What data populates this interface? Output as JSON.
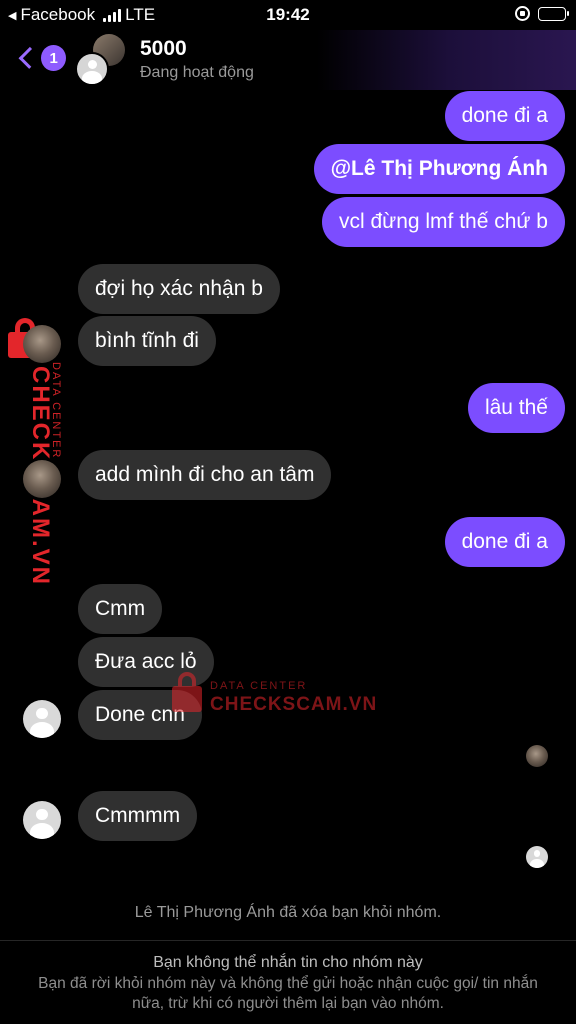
{
  "status_bar": {
    "back_app": "Facebook",
    "network": "LTE",
    "time": "19:42"
  },
  "header": {
    "unread_count": "1",
    "group_name": "5000",
    "presence": "Đang hoạt động"
  },
  "messages": [
    {
      "side": "out",
      "text": "done đi a"
    },
    {
      "side": "out",
      "text": "@Lê Thị Phương Ánh"
    },
    {
      "side": "out",
      "text": "vcl đừng lmf thế chứ b"
    },
    {
      "side": "in",
      "text": "đợi họ xác nhận b"
    },
    {
      "side": "in",
      "text": "bình tĩnh đi"
    },
    {
      "side": "out",
      "text": "lâu thế"
    },
    {
      "side": "in",
      "text": "add mình đi cho an tâm"
    },
    {
      "side": "out",
      "text": "done đi a"
    },
    {
      "side": "in",
      "text": "Cmm"
    },
    {
      "side": "in",
      "text": "Đưa acc lỏ"
    },
    {
      "side": "in",
      "text": "Done cnn"
    },
    {
      "side": "in",
      "text": "Cmmmm"
    }
  ],
  "watermark": {
    "vertical_text": "CHECKSCAM.VN",
    "vertical_small": "DATA CENTER",
    "center_small": "DATA CENTER",
    "center_big": "CHECKSCAM.VN"
  },
  "system_message": "Lê Thị Phương Ánh đã xóa bạn khỏi nhóm.",
  "footer": {
    "title": "Bạn không thể nhắn tin cho nhóm này",
    "body": "Bạn đã rời khỏi nhóm này và không thể gửi hoặc nhận cuộc gọi/ tin nhắn nữa, trừ khi có người thêm lại bạn vào nhóm."
  },
  "colors": {
    "outgoing_bubble": "#7c4dff",
    "incoming_bubble": "#303030",
    "accent": "#9b6bff",
    "watermark": "#e3262b"
  }
}
